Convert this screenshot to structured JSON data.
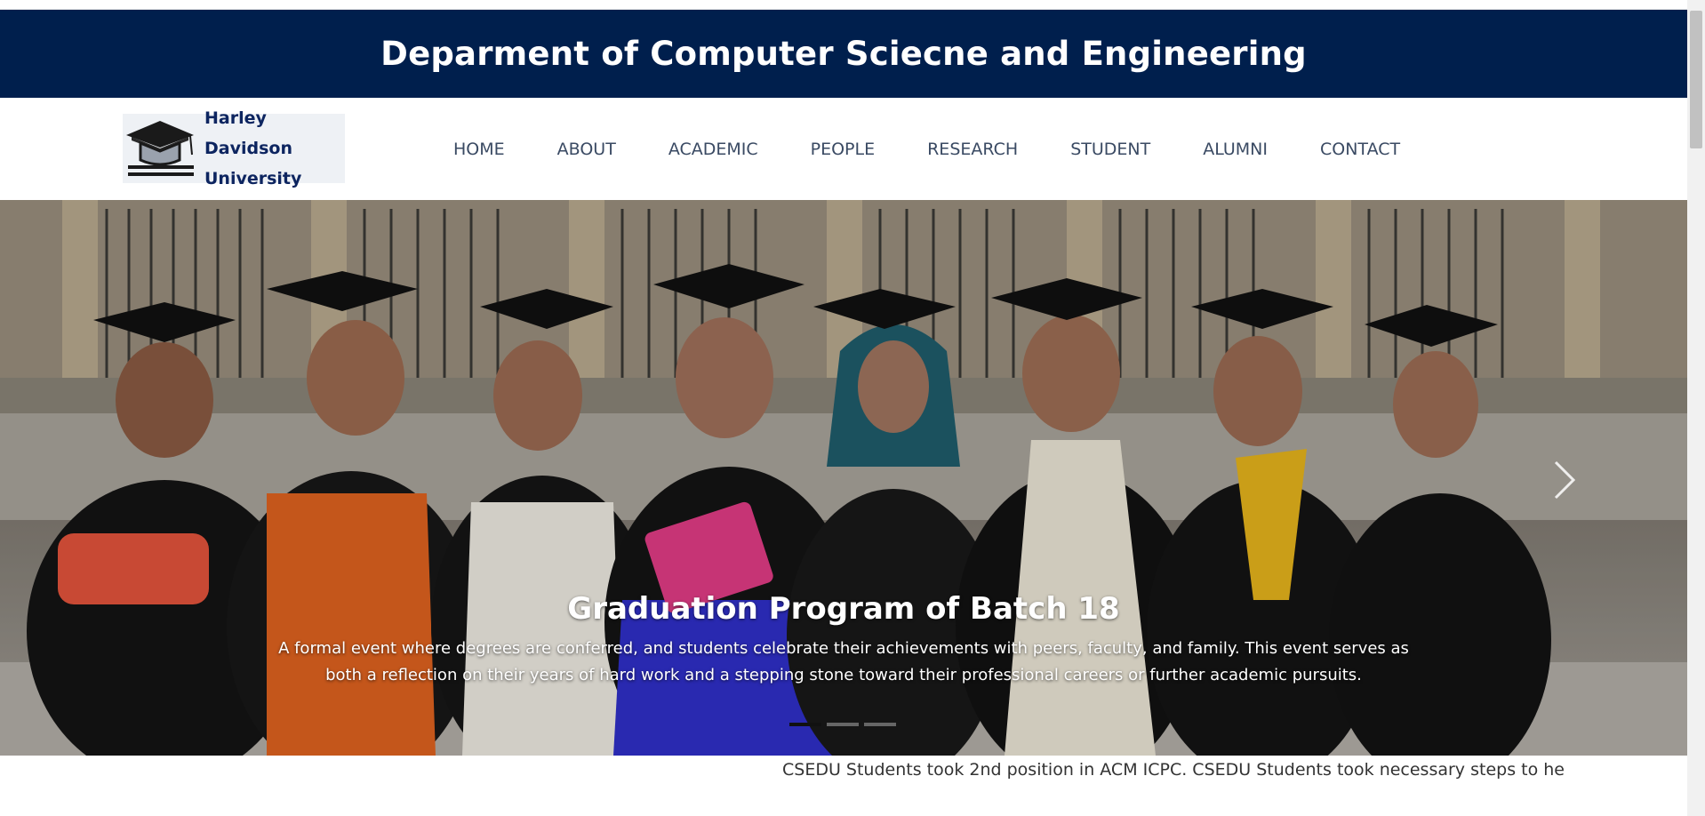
{
  "header": {
    "title": "Deparment of Computer Sciecne and Engineering"
  },
  "logo": {
    "line1": "Harley Davidson",
    "line2": "University"
  },
  "nav": {
    "items": [
      {
        "label": "HOME"
      },
      {
        "label": "ABOUT"
      },
      {
        "label": "ACADEMIC"
      },
      {
        "label": "PEOPLE"
      },
      {
        "label": "RESEARCH"
      },
      {
        "label": "STUDENT"
      },
      {
        "label": "ALUMNI"
      },
      {
        "label": "CONTACT"
      }
    ]
  },
  "carousel": {
    "caption_title": "Graduation Program of Batch 18",
    "caption_text": "A formal event where degrees are conferred, and students celebrate their achievements with peers, faculty, and family. This event serves as both a reflection on their years of hard work and a stepping stone toward their professional careers or further academic pursuits.",
    "active_slide": 1,
    "slide_count": 3
  },
  "news": {
    "ticker_text": "CSEDU Students took 2nd position in ACM ICPC. CSEDU Students took necessary steps to help the fl"
  },
  "colors": {
    "title_bar_bg": "#001f4d",
    "nav_text": "#3a4a63",
    "logo_text": "#0d2560"
  },
  "icons": {
    "logo": "graduation-cap-icon",
    "next": "chevron-right-icon"
  }
}
